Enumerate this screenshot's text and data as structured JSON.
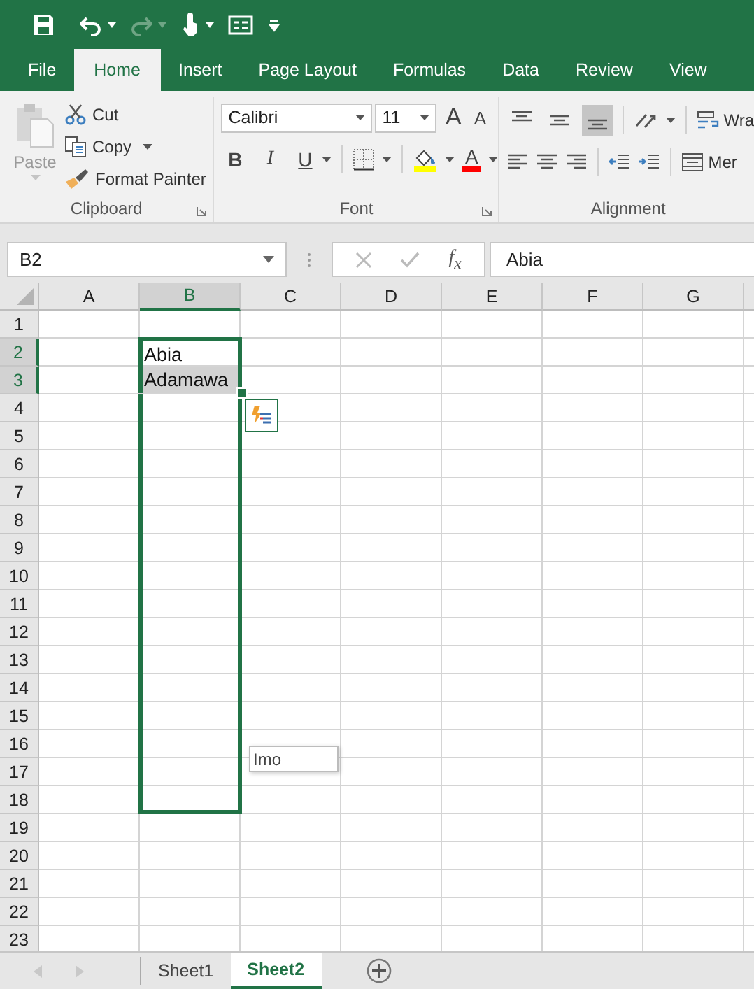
{
  "quick_access": [
    {
      "kind": "save",
      "disabled": false
    },
    {
      "kind": "undo",
      "disabled": false
    },
    {
      "kind": "redo",
      "disabled": true
    },
    {
      "kind": "touch",
      "disabled": false
    },
    {
      "kind": "form",
      "disabled": false
    },
    {
      "kind": "customize",
      "disabled": false
    }
  ],
  "tabs": [
    {
      "label": "File",
      "selected": false
    },
    {
      "label": "Home",
      "selected": true
    },
    {
      "label": "Insert",
      "selected": false
    },
    {
      "label": "Page Layout",
      "selected": false
    },
    {
      "label": "Formulas",
      "selected": false
    },
    {
      "label": "Data",
      "selected": false
    },
    {
      "label": "Review",
      "selected": false
    },
    {
      "label": "View",
      "selected": false
    }
  ],
  "clipboard": {
    "label": "Clipboard",
    "paste": {
      "label": "Paste",
      "disabled": true
    },
    "cut": "Cut",
    "copy": "Copy",
    "format_painter": "Format Painter"
  },
  "font": {
    "label": "Font",
    "name": "Calibri",
    "size": "11",
    "grow": "A",
    "shrink": "A",
    "bold": "B",
    "italic": "I",
    "underline": "U",
    "font_color": "A"
  },
  "alignment": {
    "label": "Alignment",
    "vertical": [
      {
        "selected": false
      },
      {
        "selected": false
      },
      {
        "selected": true
      }
    ],
    "wrap": "Wra",
    "merge": "Mer"
  },
  "formula_bar": {
    "name_box": "B2",
    "fx": "f$_{x}$",
    "value": "Abia"
  },
  "sheet": {
    "columns": [
      {
        "label": "A",
        "selected": false
      },
      {
        "label": "B",
        "selected": true
      },
      {
        "label": "C",
        "selected": false
      },
      {
        "label": "D",
        "selected": false
      },
      {
        "label": "E",
        "selected": false
      },
      {
        "label": "F",
        "selected": false
      },
      {
        "label": "G",
        "selected": false
      }
    ],
    "rows": [
      {
        "label": "1",
        "selected": false,
        "in_fill_range": false
      },
      {
        "label": "2",
        "selected": true,
        "active": true,
        "in_fill_range": true,
        "column_b": "Abia"
      },
      {
        "label": "3",
        "selected": true,
        "active": false,
        "in_fill_range": true,
        "column_b": "Adamawa"
      },
      {
        "label": "4",
        "selected": false,
        "in_fill_range": true,
        "options_button": true
      },
      {
        "label": "5",
        "selected": false,
        "in_fill_range": true
      },
      {
        "label": "6",
        "selected": false,
        "in_fill_range": true
      },
      {
        "label": "7",
        "selected": false,
        "in_fill_range": true
      },
      {
        "label": "8",
        "selected": false,
        "in_fill_range": true
      },
      {
        "label": "9",
        "selected": false,
        "in_fill_range": true
      },
      {
        "label": "10",
        "selected": false,
        "in_fill_range": true
      },
      {
        "label": "11",
        "selected": false,
        "in_fill_range": true
      },
      {
        "label": "12",
        "selected": false,
        "in_fill_range": true
      },
      {
        "label": "13",
        "selected": false,
        "in_fill_range": true
      },
      {
        "label": "14",
        "selected": false,
        "in_fill_range": true
      },
      {
        "label": "15",
        "selected": false,
        "in_fill_range": true
      },
      {
        "label": "16",
        "selected": false,
        "in_fill_range": true
      },
      {
        "label": "17",
        "selected": false,
        "in_fill_range": true,
        "fill_tip": "Imo"
      },
      {
        "label": "18",
        "selected": false,
        "in_fill_range": true
      },
      {
        "label": "19",
        "selected": false,
        "in_fill_range": false
      },
      {
        "label": "20",
        "selected": false,
        "in_fill_range": false
      },
      {
        "label": "21",
        "selected": false,
        "in_fill_range": false
      },
      {
        "label": "22",
        "selected": false,
        "in_fill_range": false
      },
      {
        "label": "23",
        "selected": false,
        "in_fill_range": false
      }
    ]
  },
  "sheet_tabs": [
    {
      "label": "Sheet1",
      "selected": false
    },
    {
      "label": "Sheet2",
      "selected": true
    }
  ]
}
